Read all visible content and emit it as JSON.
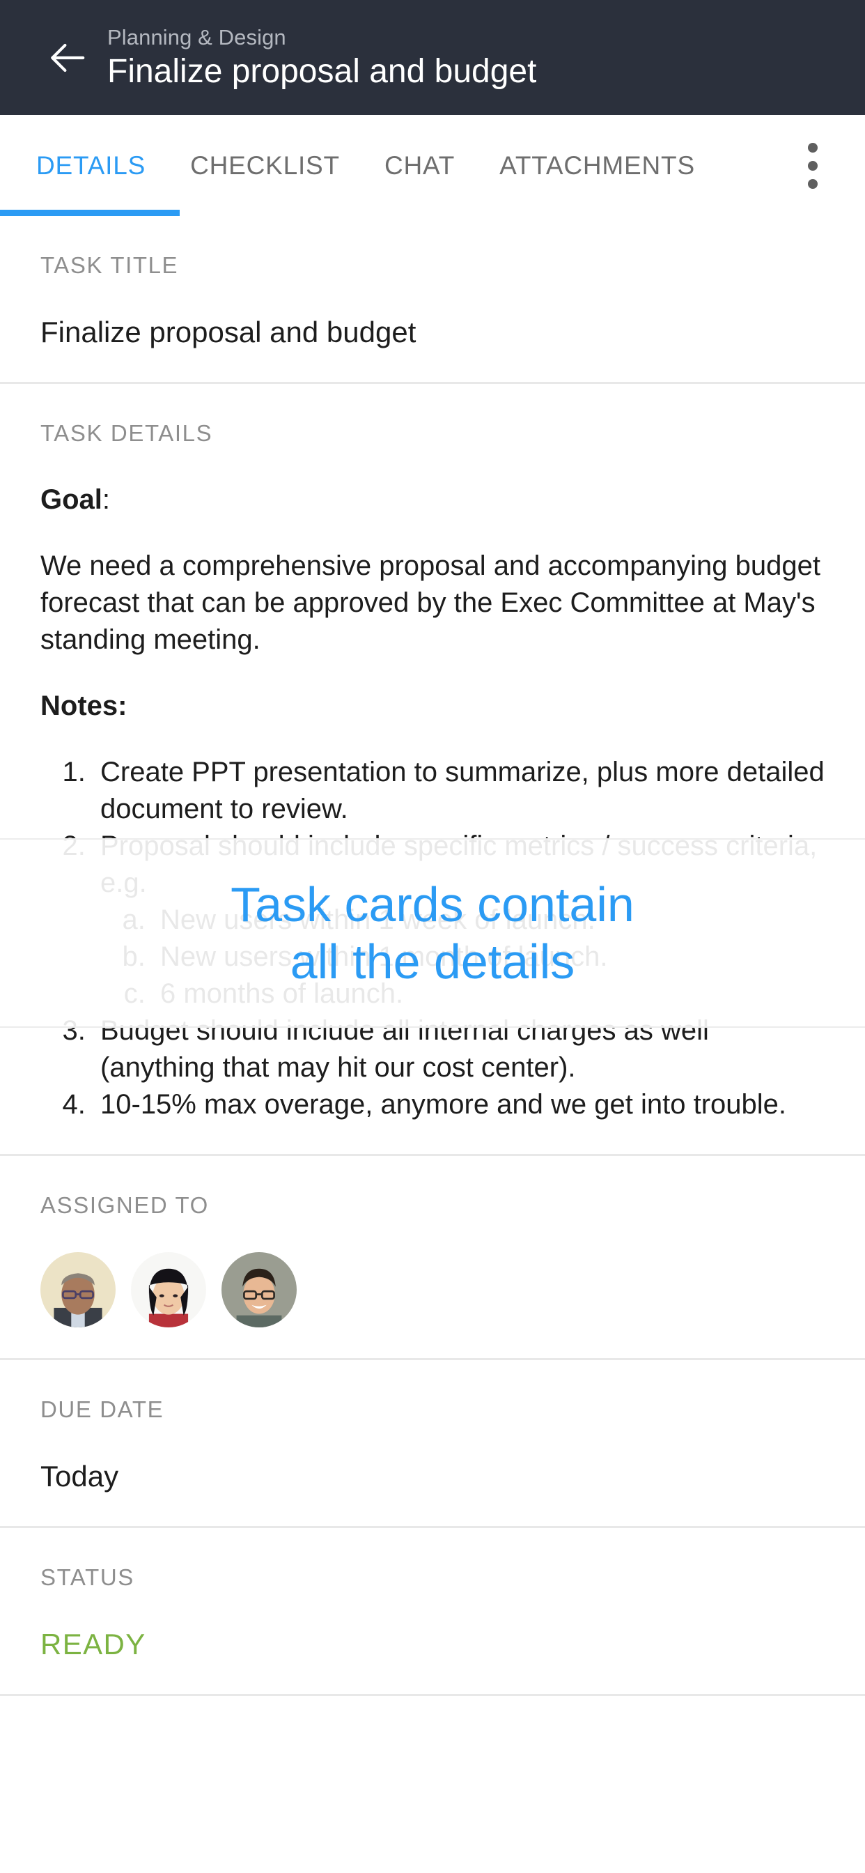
{
  "appbar": {
    "back_icon": "arrow-left-icon",
    "breadcrumb": "Planning & Design",
    "title": "Finalize proposal and budget"
  },
  "tabs": {
    "items": [
      {
        "label": "DETAILS",
        "active": true
      },
      {
        "label": "CHECKLIST",
        "active": false
      },
      {
        "label": "CHAT",
        "active": false
      },
      {
        "label": "ATTACHMENTS",
        "active": false
      }
    ],
    "overflow_icon": "more-vertical-icon",
    "active_color": "#2b9bf4"
  },
  "task_title": {
    "label": "TASK TITLE",
    "value": "Finalize proposal and budget"
  },
  "task_details": {
    "label": "TASK DETAILS",
    "goal_heading": "Goal",
    "goal_heading_colon": ":",
    "goal_body": "We need a comprehensive proposal and accompanying budget forecast that can be approved by the Exec Committee at May's standing meeting.",
    "notes_heading": "Notes:",
    "notes": [
      {
        "text": "Create PPT presentation to summarize, plus more detailed document to review."
      },
      {
        "text": "Proposal should include specific metrics / success criteria, e.g.",
        "sub": [
          "New users within 1 week of launch.",
          "New users within 1 month of launch.",
          "6 months of launch."
        ]
      },
      {
        "text": "Budget should include all internal charges as well (anything that may hit our cost center)."
      },
      {
        "text": "10-15% max overage, anymore and we get into trouble."
      }
    ]
  },
  "assigned_to": {
    "label": "ASSIGNED TO",
    "avatars": [
      {
        "name": "avatar-person-1",
        "bg": "#ece3c6",
        "skin": "#a87b5e",
        "hair": "#8c8379",
        "shirt": "#3a3f47"
      },
      {
        "name": "avatar-person-2",
        "bg": "#f7f7f5",
        "skin": "#f0c9a6",
        "hair": "#141217",
        "shirt": "#b8323a"
      },
      {
        "name": "avatar-person-3",
        "bg": "#9a9d91",
        "skin": "#e8b894",
        "hair": "#2b2119",
        "shirt": "#5c6a63"
      }
    ]
  },
  "due_date": {
    "label": "DUE DATE",
    "value": "Today"
  },
  "status": {
    "label": "STATUS",
    "value": "READY",
    "color": "#7cb342"
  },
  "coach_mark": {
    "line1": "Task cards contain",
    "line2": "all the details",
    "color": "#2b9bf4"
  }
}
